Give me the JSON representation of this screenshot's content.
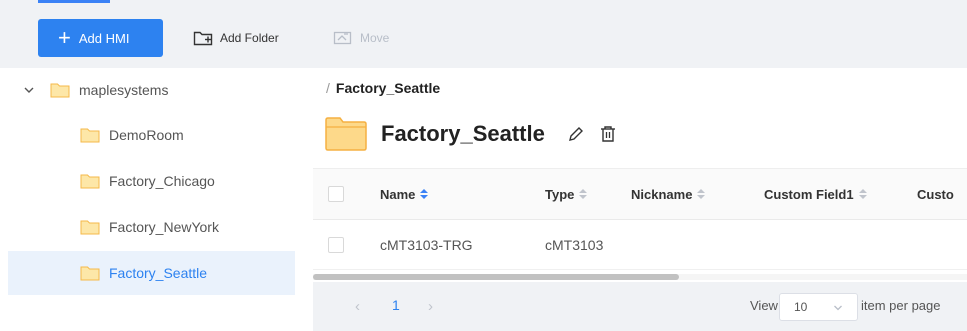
{
  "toolbar": {
    "add_hmi_label": "Add HMI",
    "add_folder_label": "Add Folder",
    "move_label": "Move",
    "accent": "#2d82f0"
  },
  "sidebar": {
    "root": {
      "label": "maplesystems",
      "icon": "folder-icon",
      "expanded": true
    },
    "items": [
      {
        "label": "DemoRoom",
        "selected": false
      },
      {
        "label": "Factory_Chicago",
        "selected": false
      },
      {
        "label": "Factory_NewYork",
        "selected": false
      },
      {
        "label": "Factory_Seattle",
        "selected": true
      }
    ]
  },
  "main": {
    "breadcrumb_sep": "/",
    "breadcrumb": "Factory_Seattle",
    "title": "Factory_Seattle",
    "icons": [
      "edit-icon",
      "trash-icon"
    ]
  },
  "table": {
    "columns": [
      "Name",
      "Type",
      "Nickname",
      "Custom Field1",
      "Custo"
    ],
    "rows": [
      {
        "name": "cMT3103-TRG",
        "type": "cMT3103",
        "nickname": "",
        "custom_field1": ""
      }
    ]
  },
  "pagination": {
    "prev": "‹",
    "page": "1",
    "next": "›",
    "view_label": "View",
    "per_page_value": "10",
    "per_page_suffix": "item per page"
  }
}
